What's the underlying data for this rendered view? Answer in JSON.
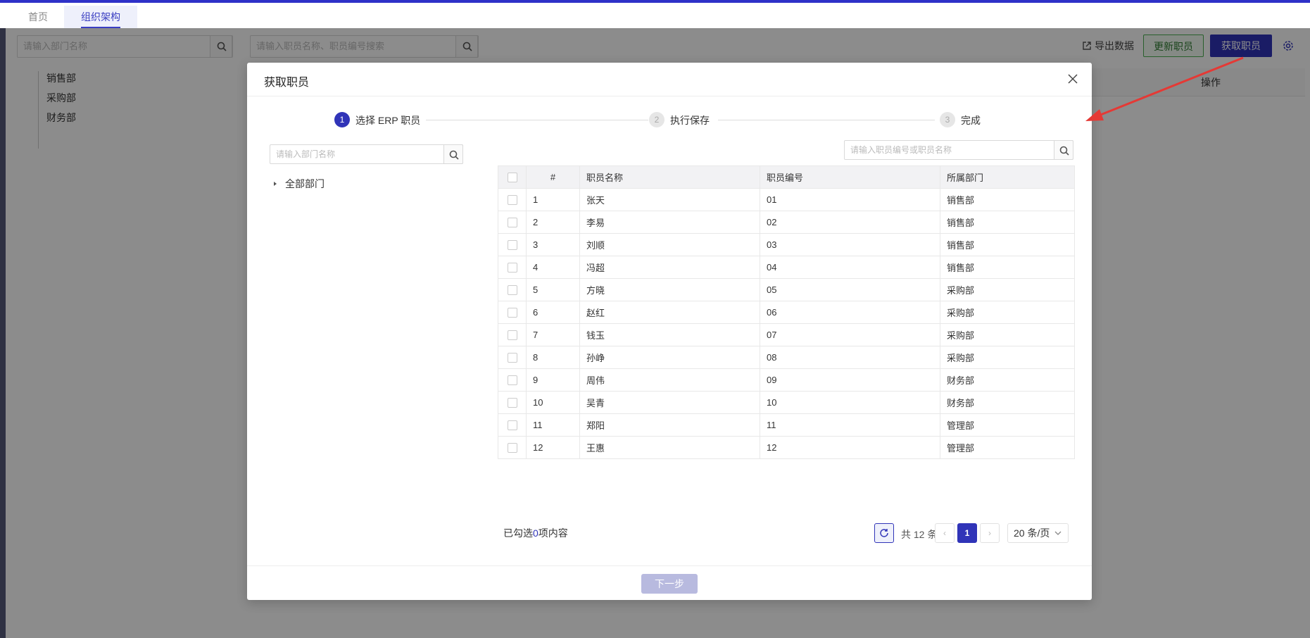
{
  "tabs": [
    {
      "label": "首页",
      "active": false
    },
    {
      "label": "组织架构",
      "active": true
    }
  ],
  "dept_panel": {
    "search_placeholder": "请输入部门名称",
    "items": [
      "销售部",
      "采购部",
      "财务部"
    ]
  },
  "main_panel": {
    "search_placeholder": "请输入职员名称、职员编号搜索",
    "export_label": "导出数据",
    "update_label": "更新职员",
    "fetch_label": "获取职员",
    "column_action": "操作"
  },
  "modal": {
    "title": "获取职员",
    "steps": [
      {
        "num": "1",
        "label": "选择 ERP 职员",
        "status": "active"
      },
      {
        "num": "2",
        "label": "执行保存",
        "status": "wait"
      },
      {
        "num": "3",
        "label": "完成",
        "status": "wait"
      }
    ],
    "dept_search_placeholder": "请输入部门名称",
    "tree_root": "全部部门",
    "emp_search_placeholder": "请输入职员编号或职员名称",
    "columns": [
      "#",
      "职员名称",
      "职员编号",
      "所属部门"
    ],
    "rows": [
      [
        "1",
        "张天",
        "01",
        "销售部"
      ],
      [
        "2",
        "李易",
        "02",
        "销售部"
      ],
      [
        "3",
        "刘顺",
        "03",
        "销售部"
      ],
      [
        "4",
        "冯超",
        "04",
        "销售部"
      ],
      [
        "5",
        "方晓",
        "05",
        "采购部"
      ],
      [
        "6",
        "赵红",
        "06",
        "采购部"
      ],
      [
        "7",
        "钱玉",
        "07",
        "采购部"
      ],
      [
        "8",
        "孙峥",
        "08",
        "采购部"
      ],
      [
        "9",
        "周伟",
        "09",
        "财务部"
      ],
      [
        "10",
        "吴青",
        "10",
        "财务部"
      ],
      [
        "11",
        "郑阳",
        "11",
        "管理部"
      ],
      [
        "12",
        "王惠",
        "12",
        "管理部"
      ]
    ],
    "selected_prefix": "已勾选",
    "selected_count": "0",
    "selected_suffix": "项内容",
    "total_label": "共 12 条",
    "current_page": "1",
    "page_size": "20 条/页",
    "next_label": "下一步"
  },
  "colors": {
    "primary": "#3034b8",
    "green": "#4caf50",
    "annotation_arrow": "#e53935"
  }
}
